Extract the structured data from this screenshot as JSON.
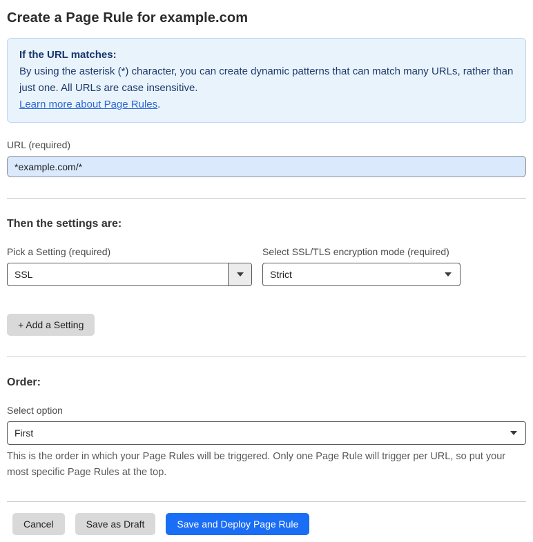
{
  "page": {
    "title": "Create a Page Rule for example.com"
  },
  "info_box": {
    "heading": "If the URL matches:",
    "body": "By using the asterisk (*) character, you can create dynamic patterns that can match many URLs, rather than just one. All URLs are case insensitive.",
    "link_label": "Learn more about Page Rules",
    "link_suffix": "."
  },
  "url_field": {
    "label": "URL (required)",
    "value": "*example.com/*"
  },
  "settings_section": {
    "heading": "Then the settings are:",
    "setting_picker": {
      "label": "Pick a Setting (required)",
      "value": "SSL"
    },
    "ssl_mode_picker": {
      "label": "Select SSL/TLS encryption mode (required)",
      "value": "Strict"
    },
    "add_setting_label": "+ Add a Setting"
  },
  "order_section": {
    "heading": "Order:",
    "select_label": "Select option",
    "value": "First",
    "help_text": "This is the order in which your Page Rules will be triggered. Only one Page Rule will trigger per URL, so put your most specific Page Rules at the top."
  },
  "footer": {
    "cancel_label": "Cancel",
    "save_draft_label": "Save as Draft",
    "save_deploy_label": "Save and Deploy Page Rule"
  },
  "colors": {
    "accent_blue": "#1a6ef5",
    "info_box_bg": "#e9f3fc",
    "info_box_border": "#bcd7f0",
    "info_text_navy": "#1e3a6d",
    "link_blue": "#2c67d6",
    "url_input_bg": "#dbe9fc",
    "gray_button_bg": "#d9d9d9"
  }
}
